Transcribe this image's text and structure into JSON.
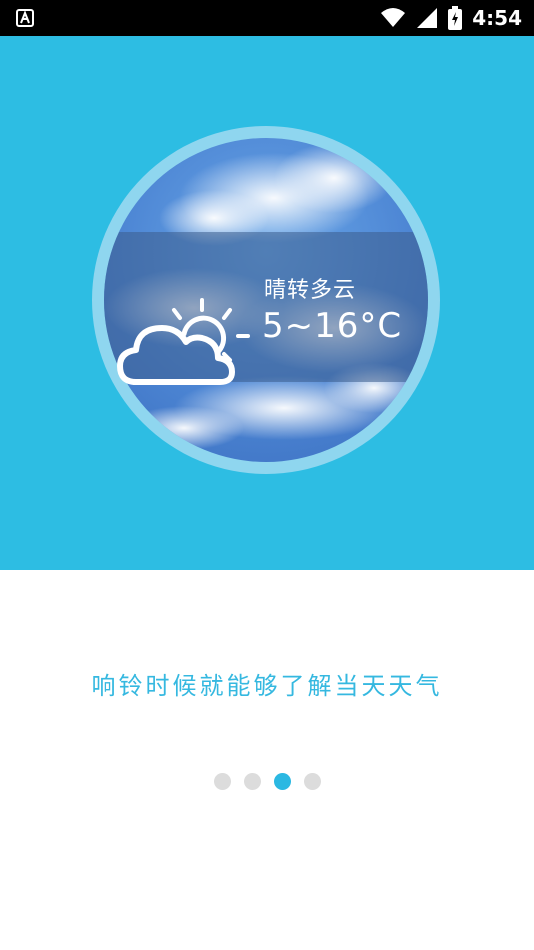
{
  "status_bar": {
    "left_icon": "a-letter-notification-icon",
    "wifi_icon": "wifi-icon",
    "signal_icon": "signal-icon",
    "battery_icon": "battery-charging-icon",
    "time": "4:54"
  },
  "hero": {
    "background_color": "#2dbde3",
    "weather": {
      "icon": "partly-cloudy-icon",
      "condition": "晴转多云",
      "temperature": "5~16°C"
    }
  },
  "caption": "响铃时候就能够了解当天天气",
  "pager": {
    "count": 4,
    "active_index": 2,
    "active_color": "#2bb8e2",
    "inactive_color": "#dcdcdc"
  }
}
